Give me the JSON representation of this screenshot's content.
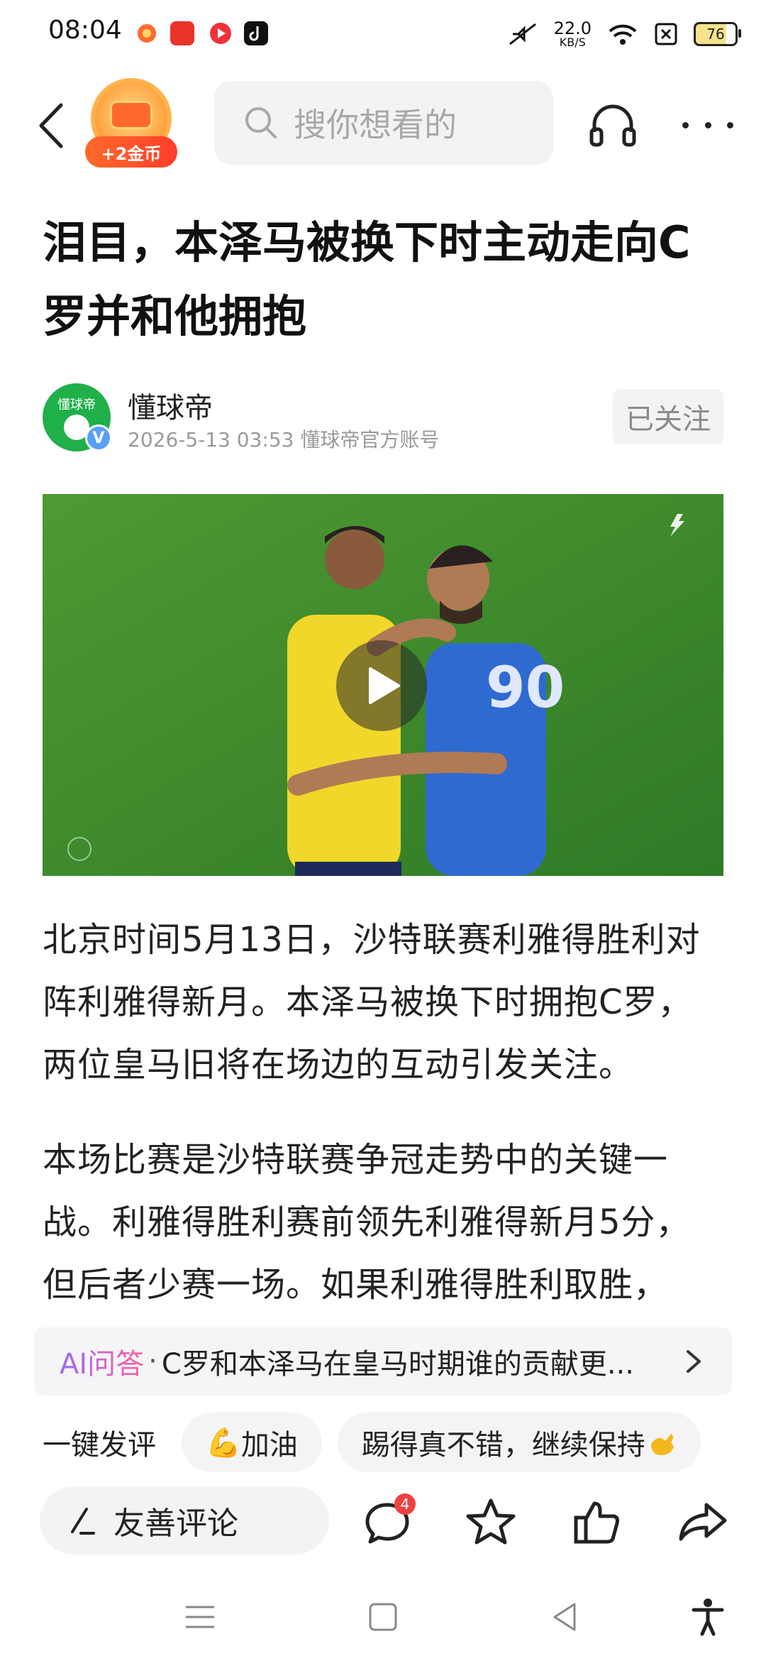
{
  "status_bar": {
    "time": "08:04",
    "net_speed_value": "22.0",
    "net_speed_unit": "KB/S",
    "battery": "76",
    "icons": [
      "app-notify-icon",
      "toutiao-app-icon",
      "red-app-icon",
      "tiktok-icon",
      "mute-icon",
      "wifi-icon",
      "sim-off-icon",
      "battery-icon"
    ]
  },
  "top_nav": {
    "coin_label": "+2金币",
    "search_placeholder": "搜你想看的"
  },
  "article": {
    "title": "泪目，本泽马被换下时主动走向C罗并和他拥抱",
    "author": "懂球帝",
    "avatar_text": "懂球帝",
    "verified_mark": "V",
    "meta": "2026-5-13   03:53   懂球帝官方账号",
    "follow_label": "已关注",
    "paragraphs": [
      "北京时间5月13日，沙特联赛利雅得胜利对阵利雅得新月。本泽马被换下时拥抱C罗，两位皇马旧将在场边的互动引发关注。",
      "本场比赛是沙特联赛争冠走势中的关键一战。利雅得胜利赛前领先利雅得新月5分，但后者少赛一场。如果利雅得胜利取胜，"
    ]
  },
  "ai_bar": {
    "label": "AI问答",
    "separator": "·",
    "question": "C罗和本泽马在皇马时期谁的贡献更..."
  },
  "quick_comments": {
    "label": "一键发评",
    "chips": [
      {
        "emoji": "💪",
        "text": "加油"
      },
      {
        "emoji": "",
        "text": "踢得真不错，继续保持"
      }
    ]
  },
  "action_bar": {
    "comment_placeholder": "友善评论",
    "comment_count": "4"
  },
  "colors": {
    "accent_orange": "#ff6a2a",
    "verified_blue": "#5aa0f5",
    "badge_red": "#f04142",
    "avatar_green": "#1fb04a"
  }
}
